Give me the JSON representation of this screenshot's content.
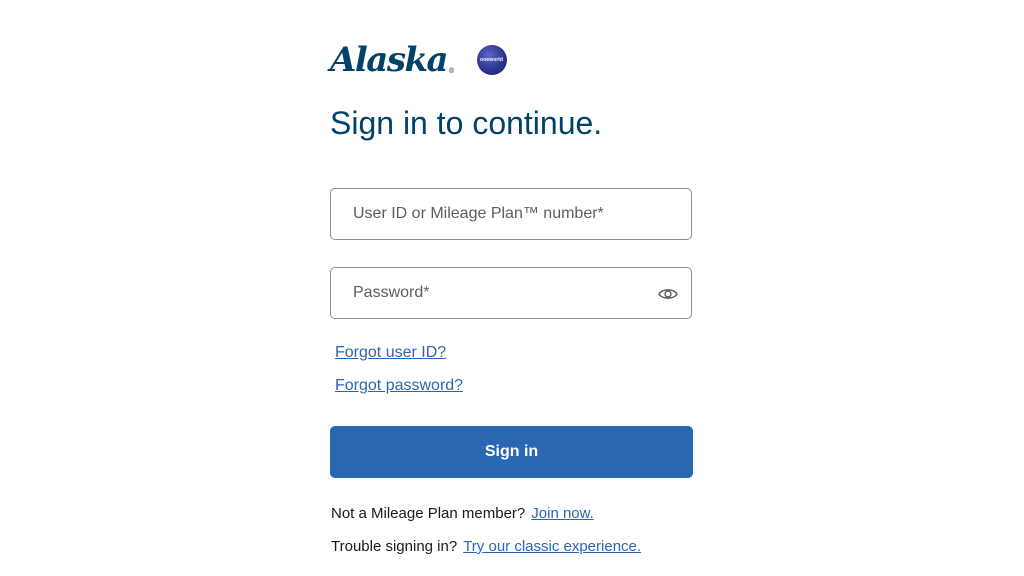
{
  "brand": {
    "logo_text": "Alaska",
    "logo_reg": "®",
    "partner_logo_text": "oneworld",
    "colors": {
      "brand_navy": "#01426a",
      "accent_blue": "#2a67b3",
      "oneworld_purple": "#2c3591"
    }
  },
  "title": "Sign in to continue.",
  "form": {
    "user_id_placeholder": "User ID or Mileage Plan™ number*",
    "user_id_value": "",
    "password_placeholder": "Password*",
    "password_value": "",
    "password_toggle_icon": "eye-icon"
  },
  "links": {
    "forgot_user_id": "Forgot user ID?",
    "forgot_password": "Forgot password?"
  },
  "signin_button": "Sign in",
  "footer": {
    "join_prompt": "Not a Mileage Plan member?",
    "join_link": "Join now.",
    "trouble_prompt": "Trouble signing in?",
    "trouble_link": "Try our classic experience."
  }
}
